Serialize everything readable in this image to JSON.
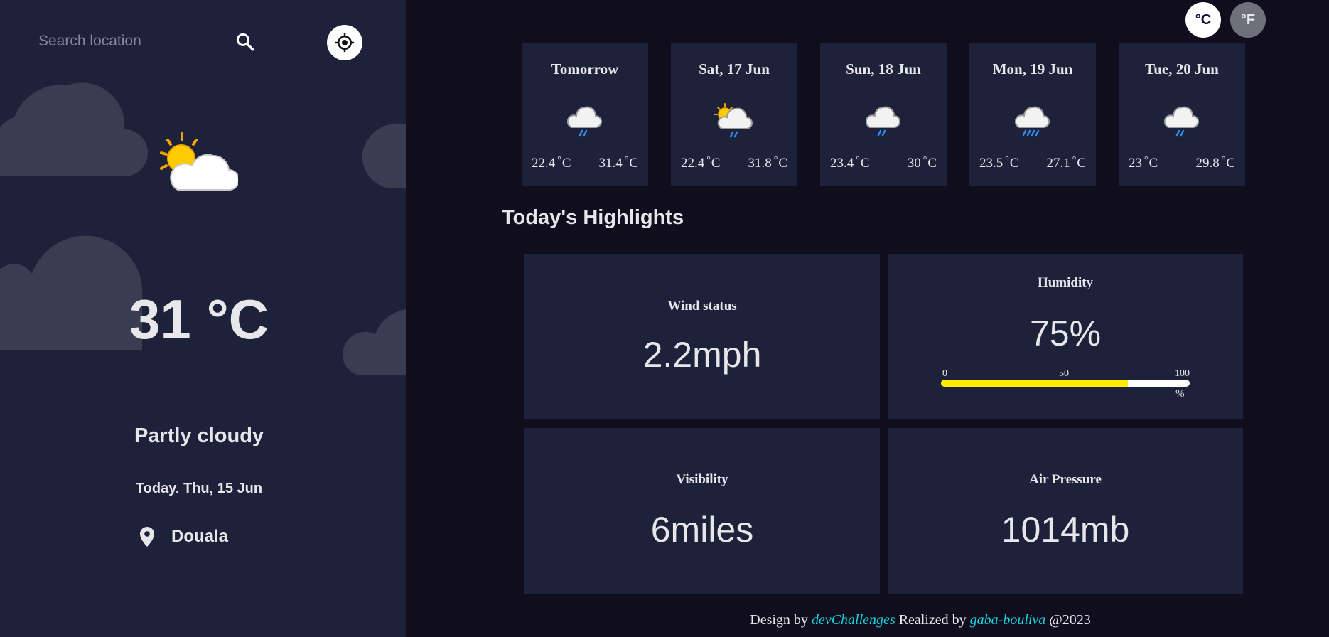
{
  "sidebar": {
    "search": {
      "placeholder": "Search location",
      "value": ""
    },
    "current": {
      "icon": "partly-cloudy-icon",
      "temp": "31 °C",
      "condition": "Partly cloudy",
      "date": "Today. Thu, 15 Jun",
      "location": "Douala"
    }
  },
  "units": {
    "celsius": "°C",
    "fahrenheit": "°F",
    "active": "celsius"
  },
  "forecast": [
    {
      "day": "Tomorrow",
      "icon": "light-rain-icon",
      "min": "22.4",
      "max": "31.4",
      "unit": "C"
    },
    {
      "day": "Sat, 17 Jun",
      "icon": "sun-cloud-rain-icon",
      "min": "22.4",
      "max": "31.8",
      "unit": "C"
    },
    {
      "day": "Sun, 18 Jun",
      "icon": "light-rain-icon",
      "min": "23.4",
      "max": "30",
      "unit": "C"
    },
    {
      "day": "Mon, 19 Jun",
      "icon": "heavy-rain-icon",
      "min": "23.5",
      "max": "27.1",
      "unit": "C"
    },
    {
      "day": "Tue, 20 Jun",
      "icon": "light-rain-icon",
      "min": "23",
      "max": "29.8",
      "unit": "C"
    }
  ],
  "highlights": {
    "title": "Today's Highlights",
    "wind": {
      "label": "Wind status",
      "value": "2.2mph"
    },
    "humidity": {
      "label": "Humidity",
      "value": "75%",
      "percent": 75,
      "scale_min": "0",
      "scale_mid": "50",
      "scale_max": "100",
      "unit": "%"
    },
    "visibility": {
      "label": "Visibility",
      "value": "6miles"
    },
    "pressure": {
      "label": "Air Pressure",
      "value": "1014mb"
    }
  },
  "footer": {
    "prefix": "Design by",
    "design_link": "devChallenges",
    "middle": "Realized by",
    "author_link": "gaba-bouliva",
    "suffix": "@2023"
  },
  "colors": {
    "bg": "#100e1d",
    "panel": "#1e213a",
    "text": "#e7e7eb",
    "humidity_fill": "#ffec00",
    "link": "#17d2dd"
  }
}
